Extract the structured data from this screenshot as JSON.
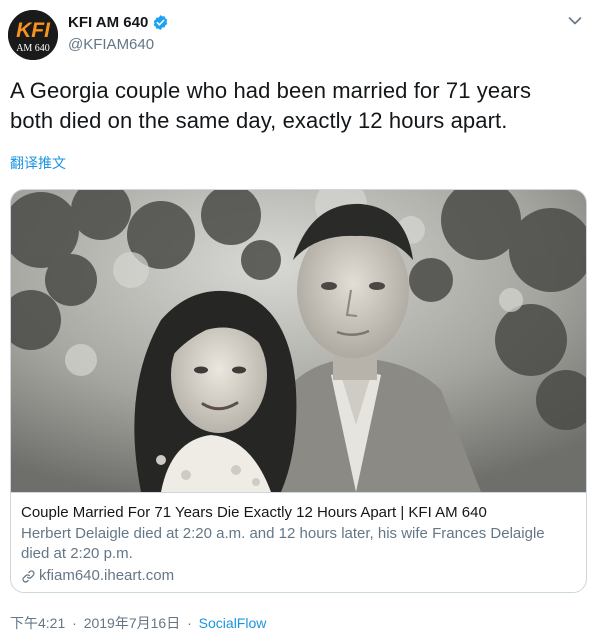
{
  "header": {
    "avatar": {
      "logo_text": "KFI",
      "sub_text": "AM 640"
    },
    "display_name": "KFI AM 640",
    "verified_icon": "verified-badge-icon",
    "handle": "@KFIAM640",
    "menu_icon": "chevron-down-icon"
  },
  "tweet": {
    "text": "A Georgia couple who had been married for 71 years both died on the same day, exactly 12 hours apart.",
    "translate_label": "翻译推文"
  },
  "card": {
    "image_alt": "black-and-white photo of couple",
    "title": "Couple Married For 71 Years Die Exactly 12 Hours Apart | KFI AM 640",
    "description": "Herbert Delaigle died at 2:20 a.m. and 12 hours later, his wife Frances Delaigle died at 2:20 p.m.",
    "link_icon": "link-icon",
    "domain": "kfiam640.iheart.com"
  },
  "footer": {
    "time": "下午4:21",
    "separator": "·",
    "date": "2019年7月16日",
    "source": "SocialFlow"
  },
  "colors": {
    "link_blue": "#1b95e0",
    "muted": "#657786",
    "text": "#14171a",
    "verified": "#1da1f2",
    "logo_orange": "#f7941d"
  }
}
